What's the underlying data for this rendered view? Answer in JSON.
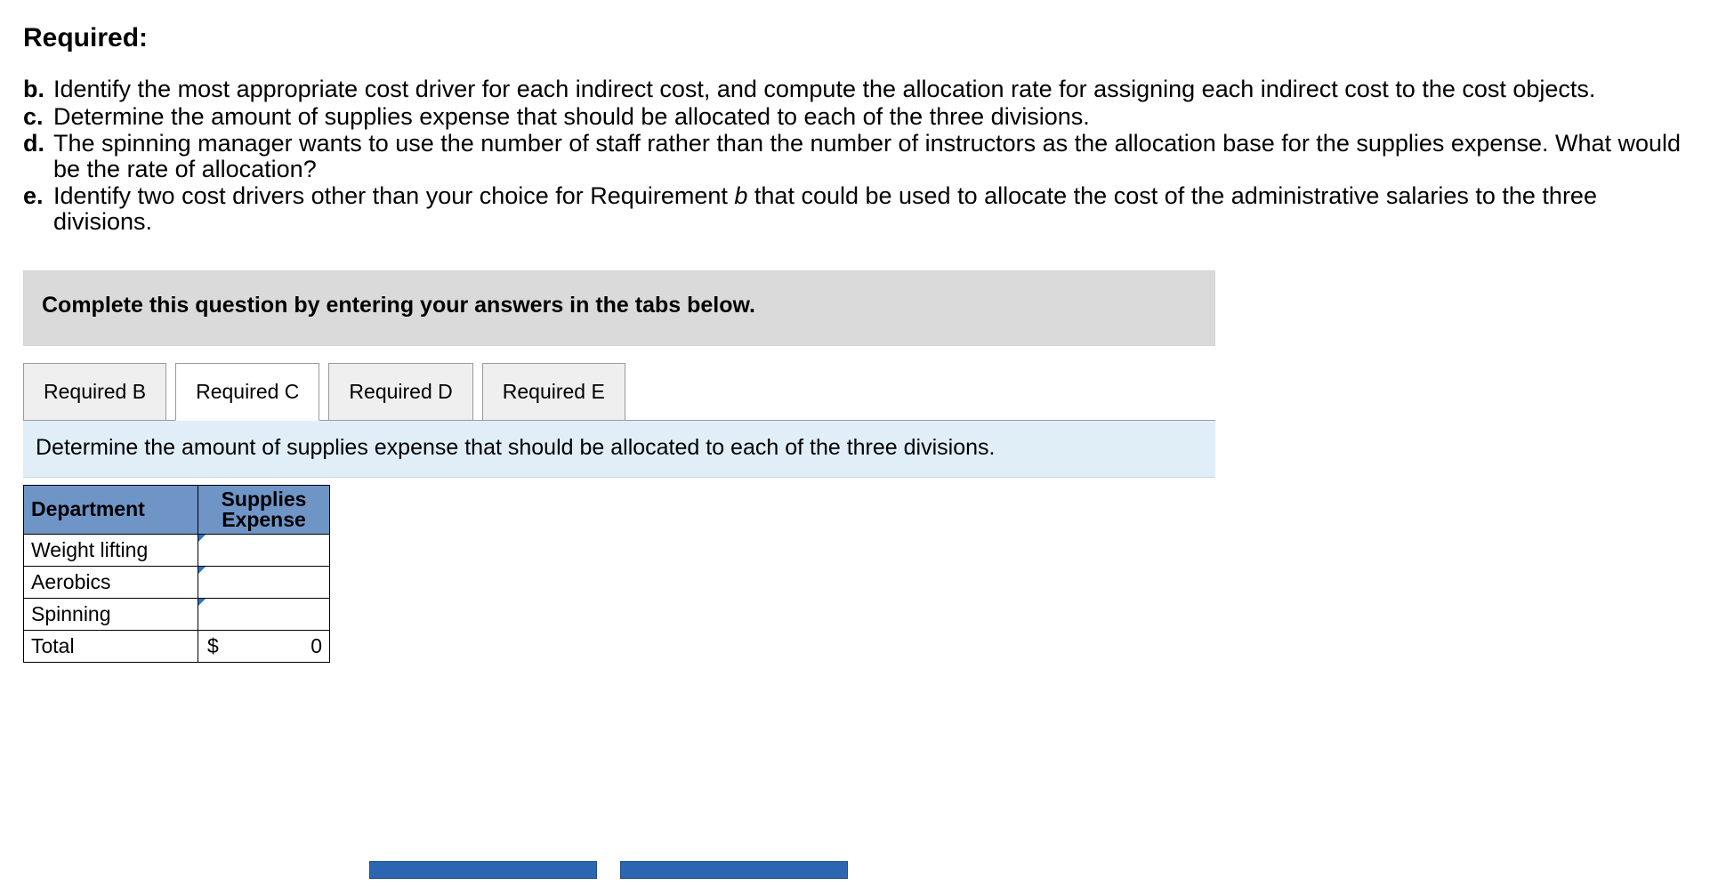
{
  "heading": "Required:",
  "requirements": [
    {
      "marker": "b.",
      "html": "Identify the most appropriate cost driver for each indirect cost, and compute the allocation rate for assigning each indirect cost to the cost objects."
    },
    {
      "marker": "c.",
      "html": "Determine the amount of supplies expense that should be allocated to each of the three divisions."
    },
    {
      "marker": "d.",
      "html": "The spinning manager wants to use the number of staff rather than the number of instructors as the allocation base for the supplies expense. What would be the rate of allocation?"
    },
    {
      "marker": "e.",
      "html": "Identify two cost drivers other than your choice for Requirement <i>b</i> that could be used to allocate the cost of the administrative salaries to the three divisions."
    }
  ],
  "instruction_bar": "Complete this question by entering your answers in the tabs below.",
  "tabs": [
    {
      "id": "req-b",
      "label": "Required B",
      "active": false
    },
    {
      "id": "req-c",
      "label": "Required C",
      "active": true
    },
    {
      "id": "req-d",
      "label": "Required D",
      "active": false
    },
    {
      "id": "req-e",
      "label": "Required E",
      "active": false
    }
  ],
  "panel_text": "Determine the amount of supplies expense that should be allocated to each of the three divisions.",
  "table": {
    "headers": {
      "dept": "Department",
      "supp_line1": "Supplies",
      "supp_line2": "Expense"
    },
    "rows": [
      {
        "dept": "Weight lifting"
      },
      {
        "dept": "Aerobics"
      },
      {
        "dept": "Spinning"
      }
    ],
    "total_row": {
      "label": "Total",
      "currency": "$",
      "value": "0"
    }
  },
  "nav": {
    "prev": "",
    "next": ""
  }
}
